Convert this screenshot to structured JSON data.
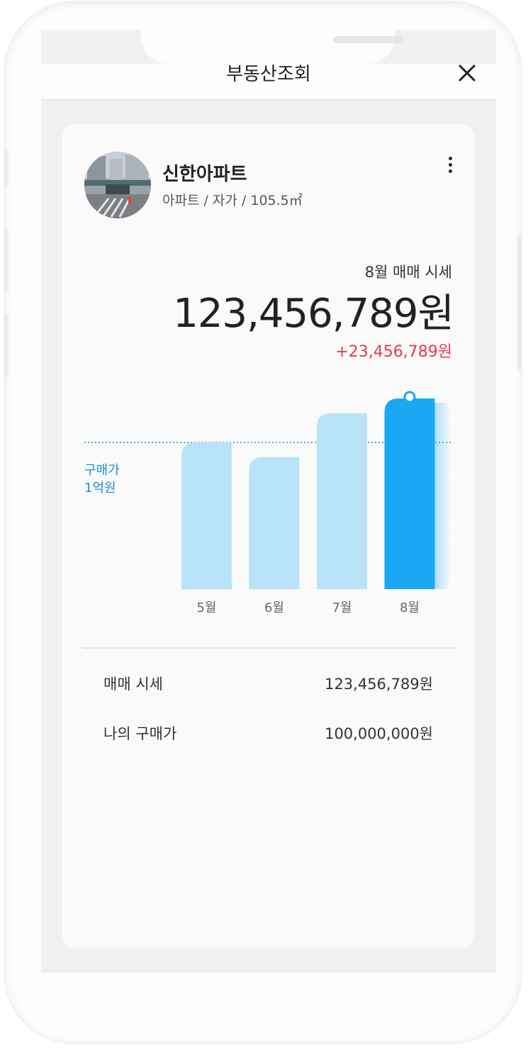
{
  "header": {
    "title": "부동산조회"
  },
  "property": {
    "name": "신한아파트",
    "subtitle": "아파트 / 자가 / 105.5㎡"
  },
  "price": {
    "label": "8월 매매 시세",
    "value": "123,456,789원",
    "change": "+23,456,789원",
    "change_color": "#e63950"
  },
  "chart_data": {
    "type": "bar",
    "categories": [
      "5월",
      "6월",
      "7월",
      "8월"
    ],
    "values": [
      1.0,
      0.9,
      1.2,
      1.3
    ],
    "highlight_index": 3,
    "ylim": [
      0,
      1.3
    ],
    "reference_line": {
      "label": "구매가",
      "value_label": "1억원",
      "value": 1.0
    },
    "colors": {
      "bar": "#b8e3f8",
      "highlight": "#1aa8f4",
      "reference": "#1a8fd8"
    }
  },
  "details": [
    {
      "label": "매매 시세",
      "value": "123,456,789원"
    },
    {
      "label": "나의 구매가",
      "value": "100,000,000원"
    }
  ]
}
